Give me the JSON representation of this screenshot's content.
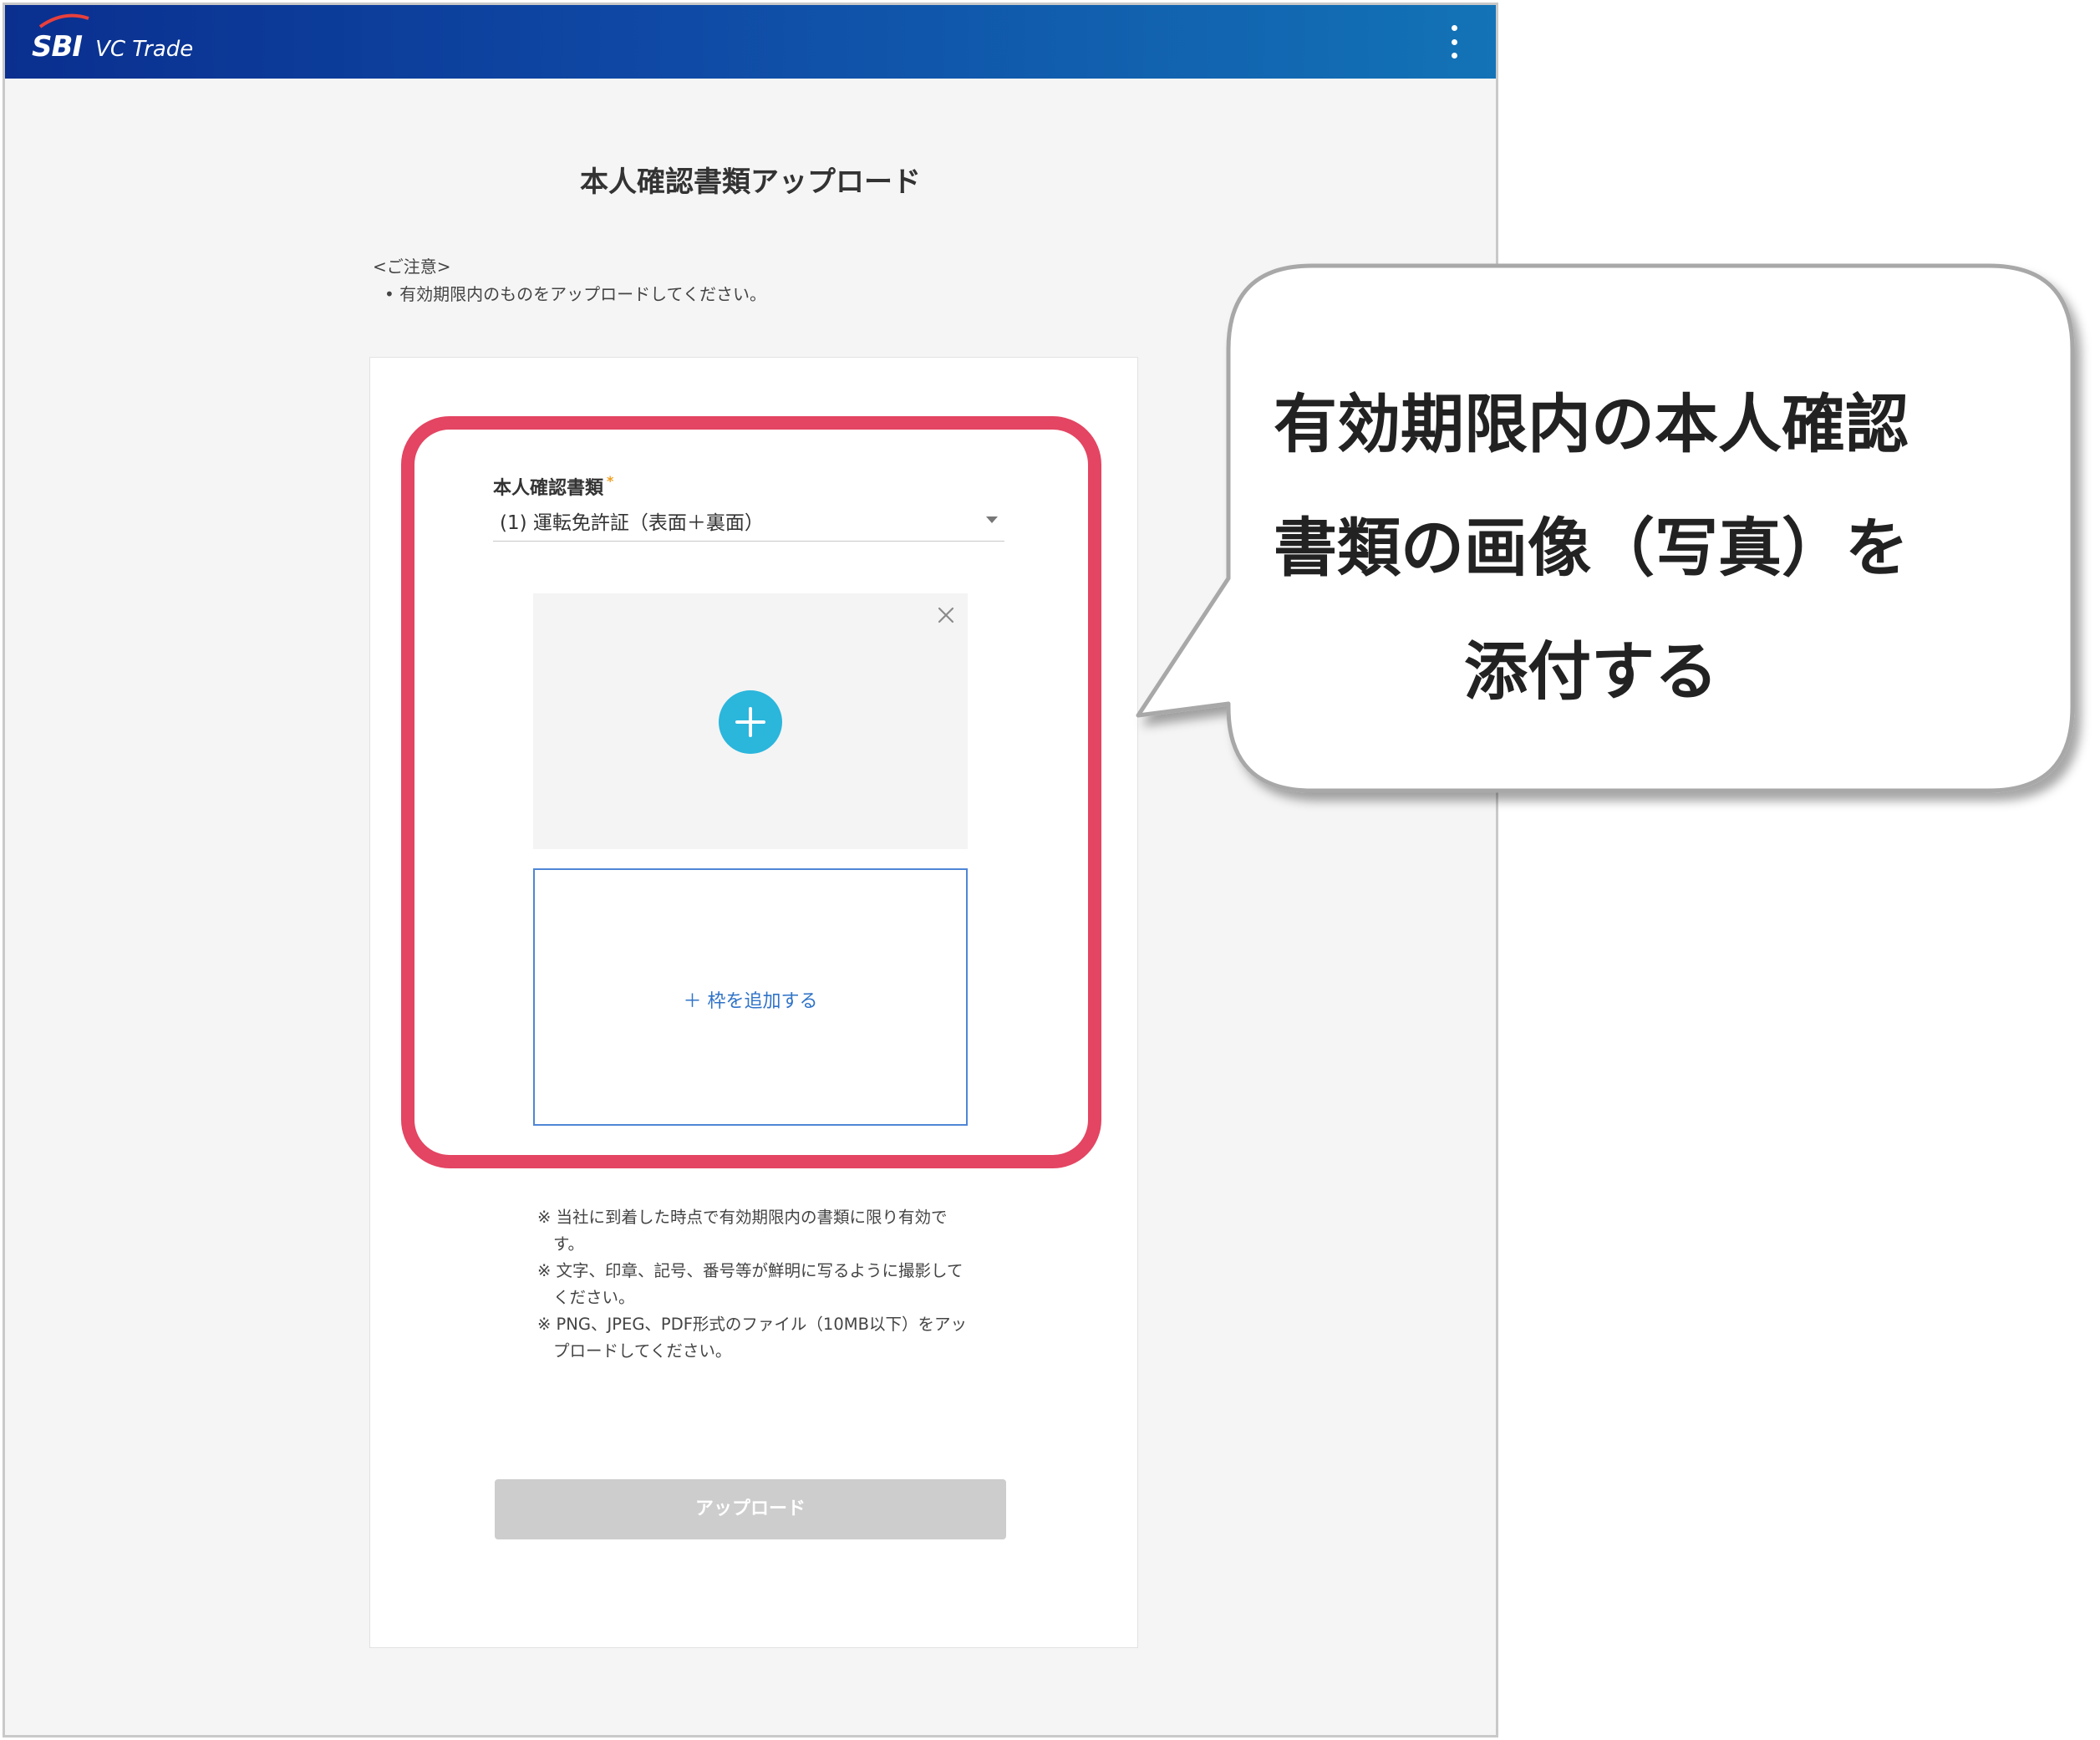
{
  "app": {
    "logo_brand": "SBI",
    "logo_product": "VC Trade"
  },
  "page": {
    "title": "本人確認書類アップロード"
  },
  "notice": {
    "heading": "<ご注意>",
    "items": [
      "有効期限内のものをアップロードしてください。"
    ]
  },
  "form": {
    "doc_label": "本人確認書類",
    "required_mark": "*",
    "doc_select_value": "(1) 運転免許証（表面＋裏面）",
    "add_frame_label": "＋ 枠を追加する",
    "notes": [
      "※ 当社に到着した時点で有効期限内の書類に限り有効です。",
      "※ 文字、印章、記号、番号等が鮮明に写るように撮影してください。",
      "※ PNG、JPEG、PDF形式のファイル（10MB以下）をアップロードしてください。"
    ],
    "upload_button": "アップロード"
  },
  "callout": {
    "lines": [
      "有効期限内の本人確認",
      "書類の画像（写真）を",
      "添付する"
    ]
  },
  "colors": {
    "header_start": "#0a2f8f",
    "header_end": "#1373b6",
    "highlight": "#e34562",
    "plus_button": "#2bb6dc",
    "link": "#2f73c8",
    "button_disabled": "#cdcdcd"
  },
  "icons": {
    "menu": "vertical-dots-icon",
    "close": "close-icon",
    "add": "plus-circle-icon",
    "select": "caret-down-icon"
  }
}
